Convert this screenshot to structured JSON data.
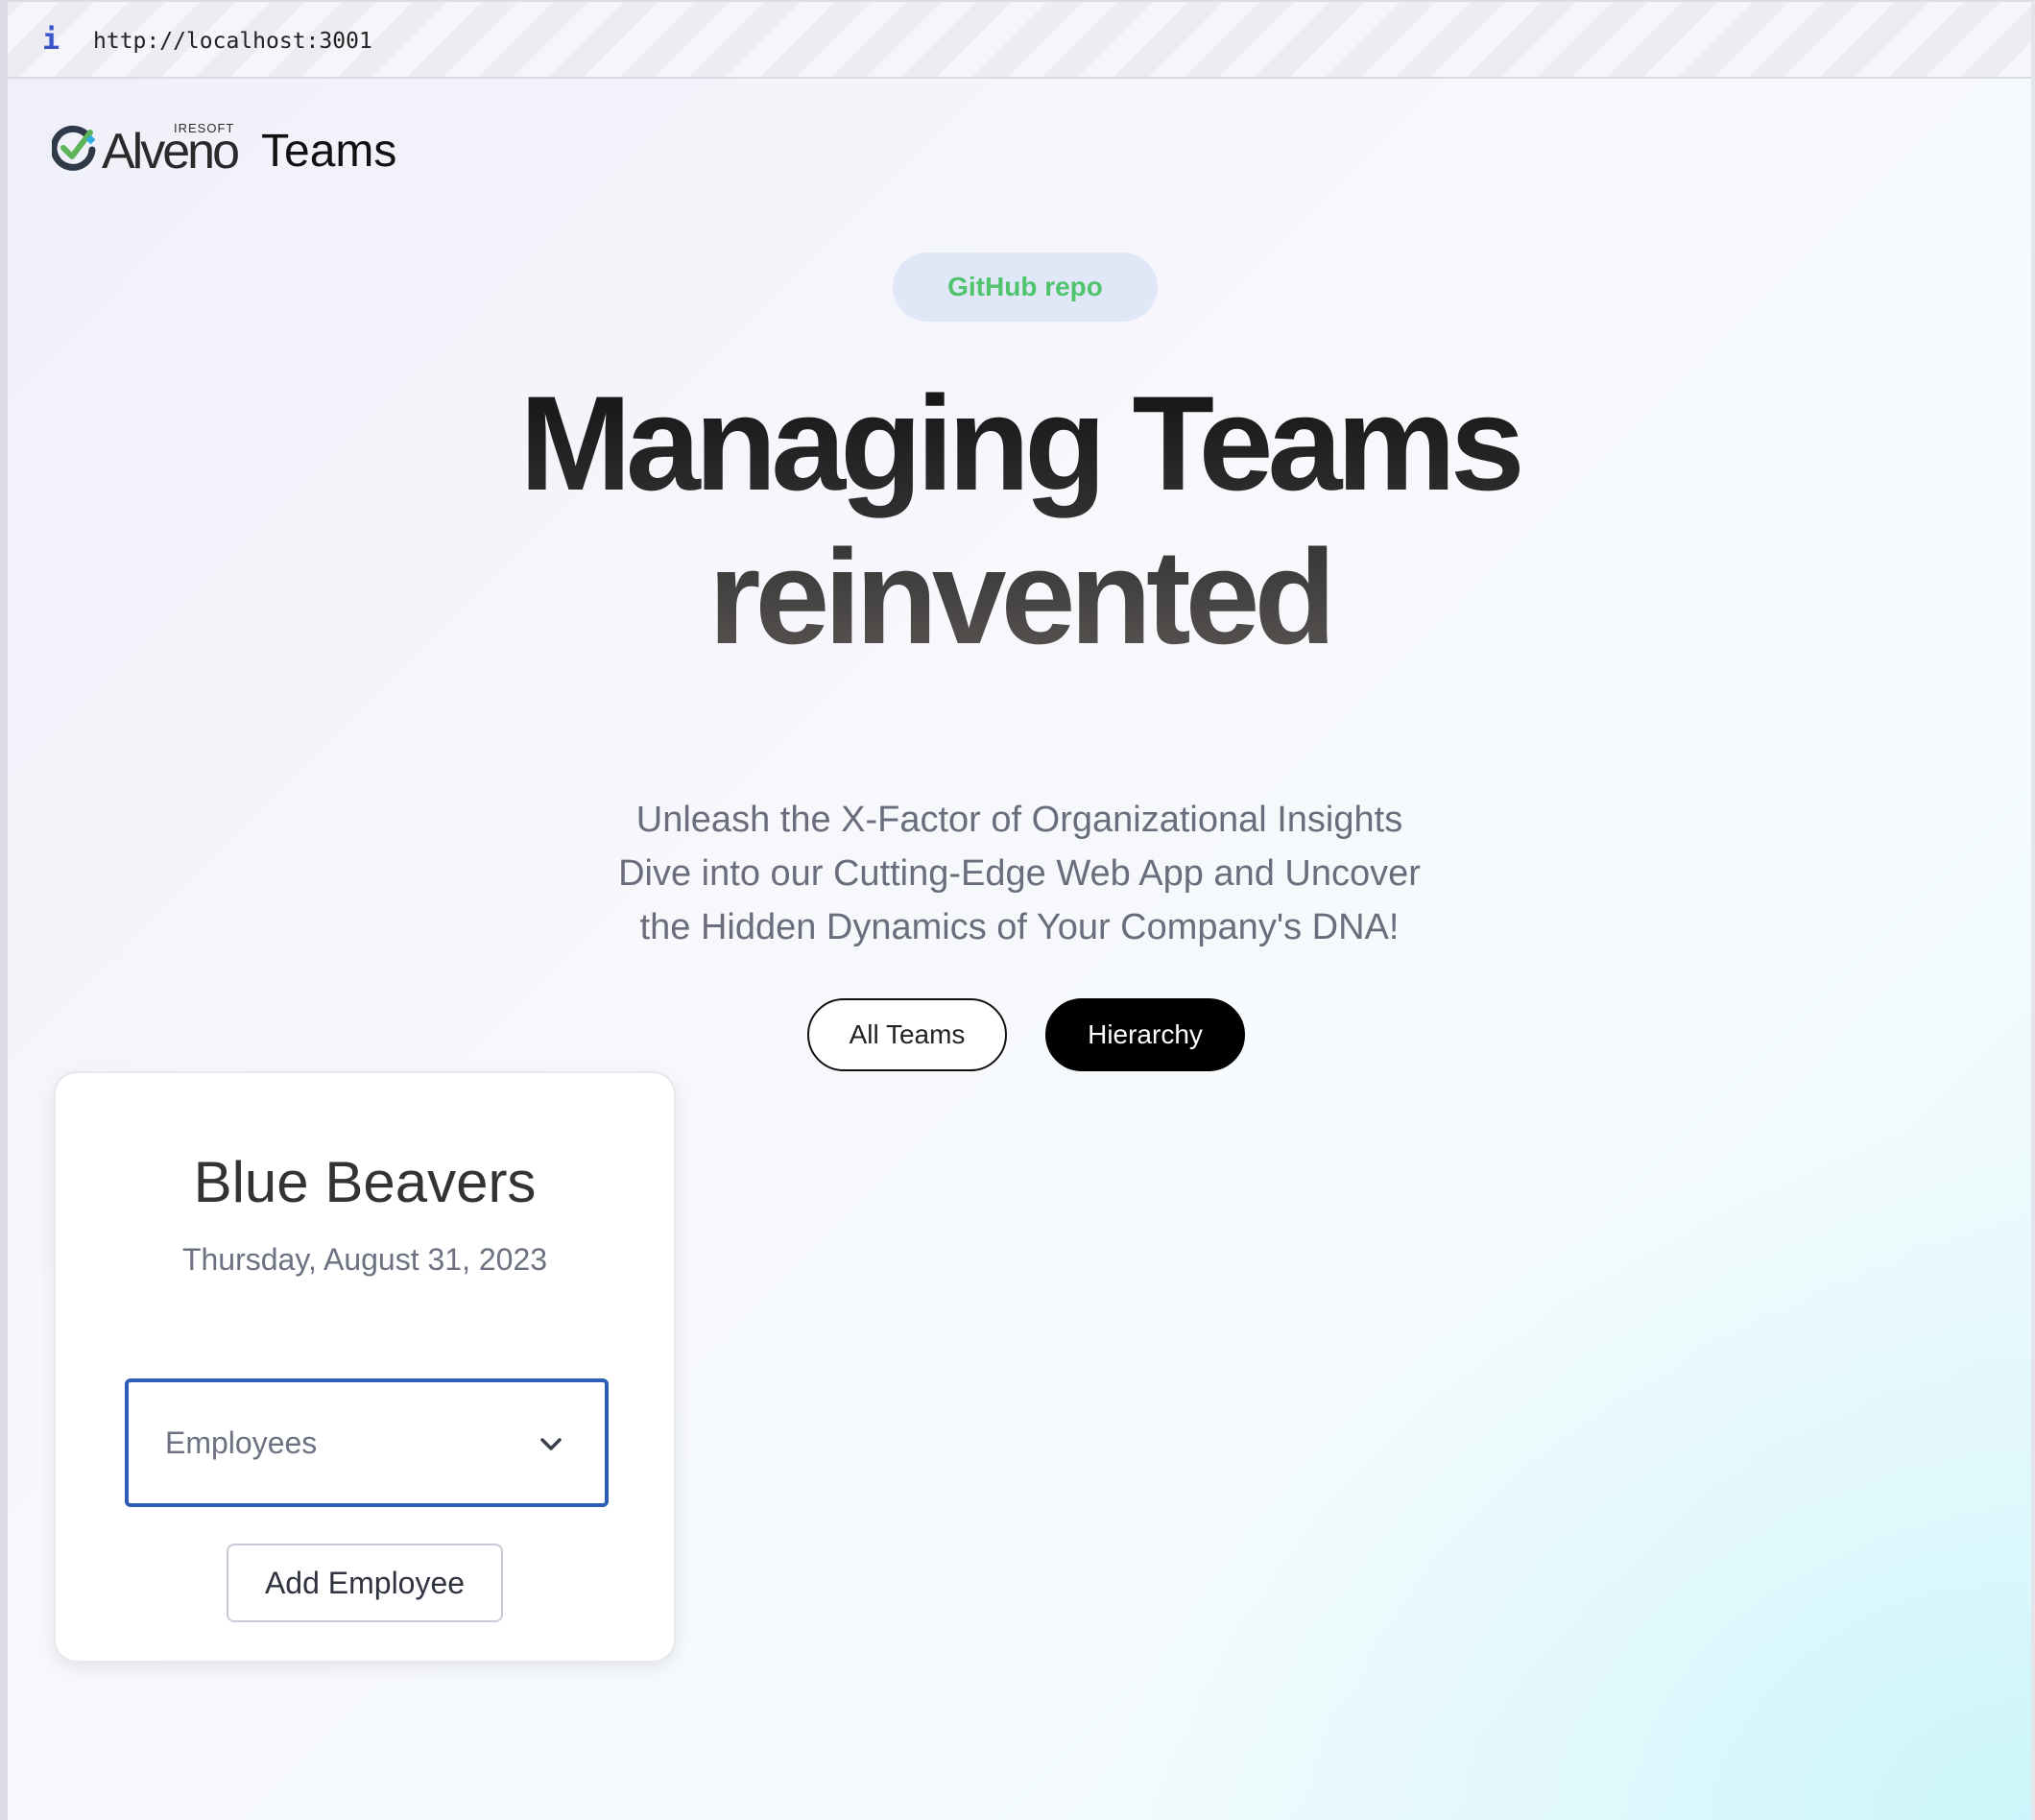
{
  "browser": {
    "info_icon": "i",
    "url": "http://localhost:3001"
  },
  "header": {
    "logo": {
      "small_text": "IRESOFT",
      "brand": "Alveno",
      "product": "Teams"
    }
  },
  "hero": {
    "github_label": "GitHub repo",
    "title_line1": "Managing Teams",
    "title_line2": "reinvented",
    "subtitle_lines": [
      "Unleash the X-Factor of Organizational Insights",
      "Dive into our Cutting-Edge Web App and Uncover",
      "the Hidden Dynamics of Your Company's DNA!"
    ],
    "buttons": {
      "all_teams": "All Teams",
      "hierarchy": "Hierarchy"
    }
  },
  "team_card": {
    "name": "Blue Beavers",
    "date": "Thursday, August 31, 2023",
    "select": {
      "selected": "Employees",
      "icon": "chevron-down-icon"
    },
    "add_button": "Add Employee"
  },
  "colors": {
    "github_text": "#4fc46d",
    "github_bg": "#e0e8f8",
    "select_border": "#2e5db8",
    "primary_button_bg": "#000000"
  }
}
